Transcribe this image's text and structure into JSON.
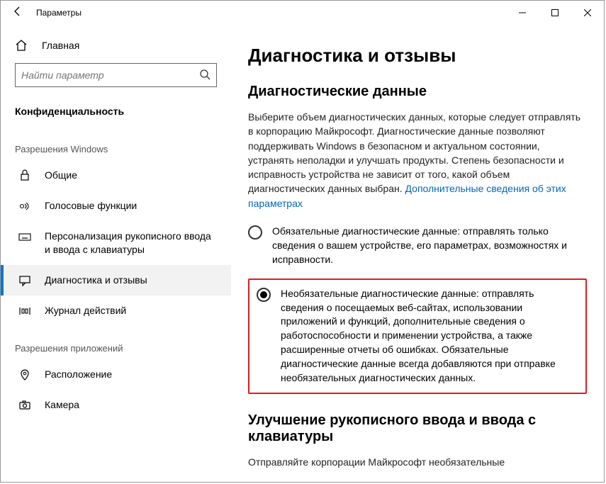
{
  "window": {
    "title": "Параметры"
  },
  "sidebar": {
    "home": "Главная",
    "search_placeholder": "Найти параметр",
    "section": "Конфиденциальность",
    "group1_title": "Разрешения Windows",
    "group2_title": "Разрешения приложений",
    "items_g1": [
      {
        "label": "Общие"
      },
      {
        "label": "Голосовые функции"
      },
      {
        "label": "Персонализация рукописного ввода и ввода с клавиатуры"
      },
      {
        "label": "Диагностика и отзывы"
      },
      {
        "label": "Журнал действий"
      }
    ],
    "items_g2": [
      {
        "label": "Расположение"
      },
      {
        "label": "Камера"
      }
    ]
  },
  "main": {
    "title": "Диагностика и отзывы",
    "h2_1": "Диагностические данные",
    "intro": "Выберите объем диагностических данных, которые следует отправлять в корпорацию Майкрософт. Диагностические данные позволяют поддерживать Windows в безопасном и актуальном состоянии, устранять неполадки и улучшать продукты. Степень безопасности и исправность устройства не зависит от того, какой объем диагностических данных выбран. ",
    "intro_link": "Дополнительные сведения об этих параметрах",
    "radio1": "Обязательные диагностические данные: отправлять только сведения о вашем устройстве, его параметрах, возможностях и исправности.",
    "radio2": "Необязательные диагностические данные: отправлять сведения о посещаемых веб-сайтах, использовании приложений и функций, дополнительные сведения о работоспособности и применении устройства, а также расширенные отчеты об ошибках. Обязательные диагностические данные всегда добавляются при отправке необязательных диагностических данных.",
    "h2_2": "Улучшение рукописного ввода и ввода с клавиатуры",
    "p2": "Отправляйте корпорации Майкрософт необязательные"
  }
}
